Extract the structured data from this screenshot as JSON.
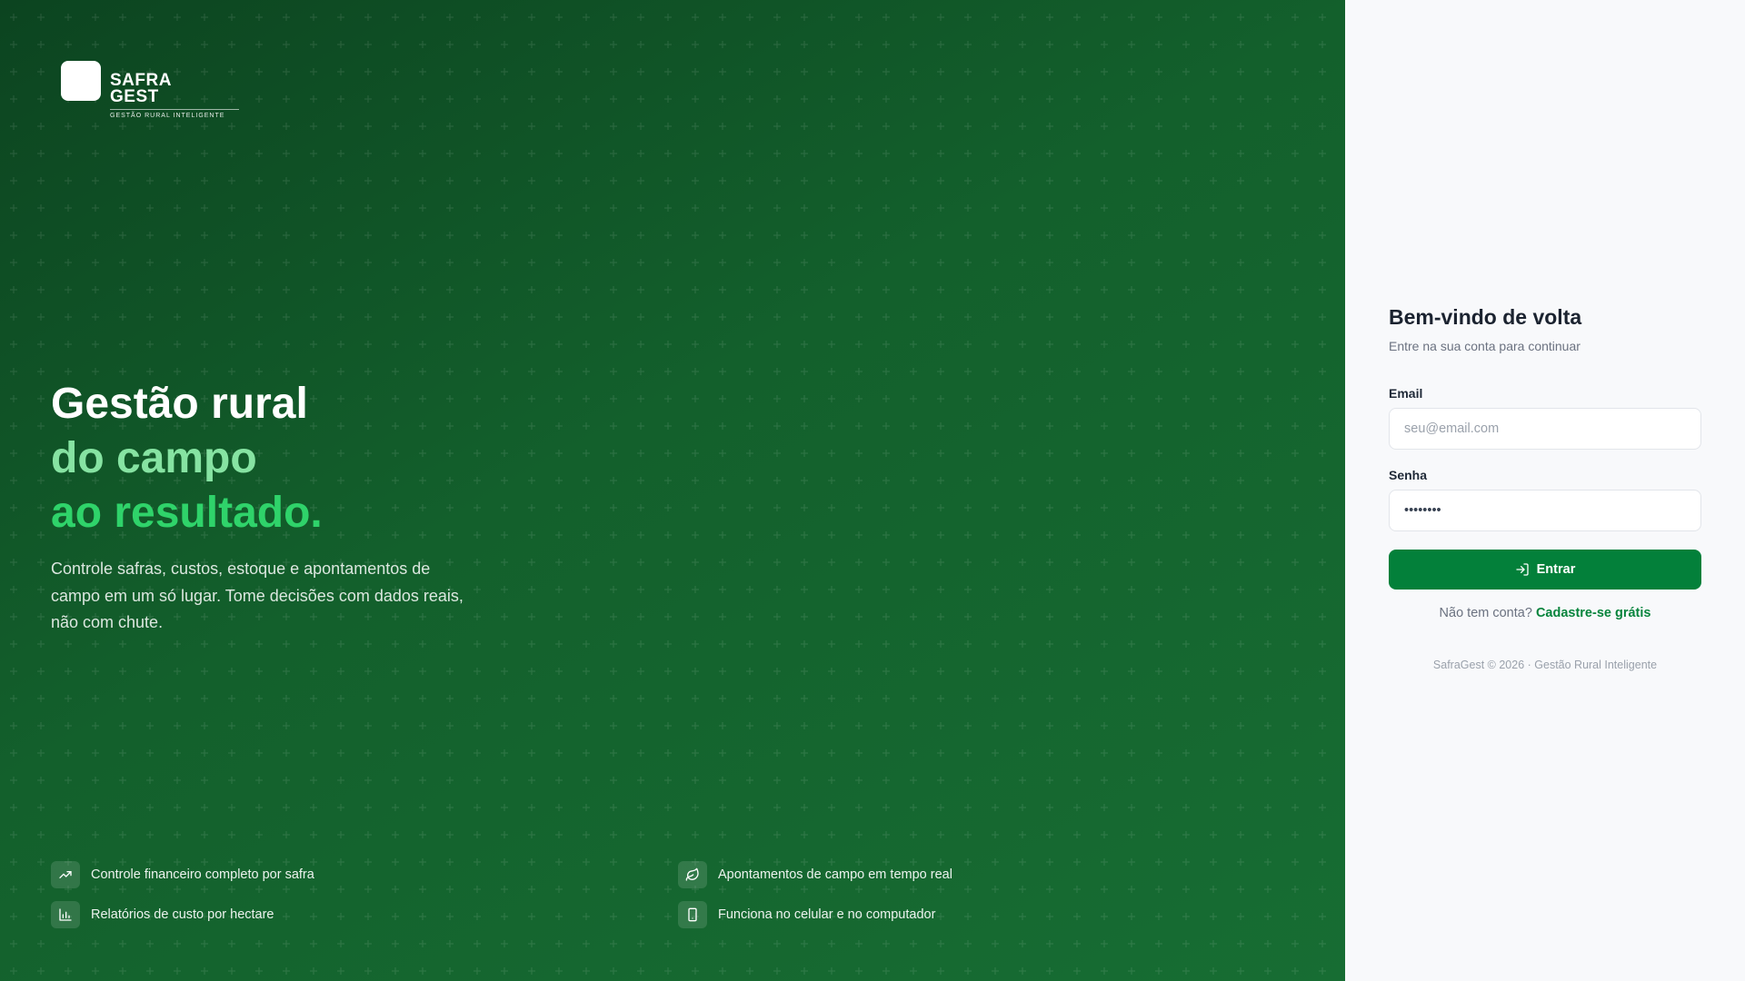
{
  "brand": {
    "line1": "SAFRA",
    "line2": "GEST",
    "tagline": "GESTÃO RURAL INTELIGENTE"
  },
  "hero": {
    "headline_line1": "Gestão rural",
    "headline_line2": "do campo",
    "headline_line3": "ao resultado.",
    "subtitle": "Controle safras, custos, estoque e apontamentos de campo em um só lugar. Tome decisões com dados reais, não com chute.",
    "features": [
      {
        "label": "Controle financeiro completo por safra",
        "icon": "trending-up-icon"
      },
      {
        "label": "Apontamentos de campo em tempo real",
        "icon": "leaf-icon"
      },
      {
        "label": "Relatórios de custo por hectare",
        "icon": "bar-chart-icon"
      },
      {
        "label": "Funciona no celular e no computador",
        "icon": "smartphone-icon"
      }
    ]
  },
  "login": {
    "title": "Bem-vindo de volta",
    "subtitle": "Entre na sua conta para continuar",
    "email_label": "Email",
    "email_placeholder": "seu@email.com",
    "password_label": "Senha",
    "password_value": "••••••••",
    "submit_label": "Entrar",
    "signup_prompt": "Não tem conta?",
    "signup_link": "Cadastre-se grátis",
    "footer": "SafraGest © 2026 · Gestão Rural Inteligente"
  },
  "colors": {
    "primary": "#03803a",
    "hero_dark": "#0c4420",
    "accent_light": "#86e3a2",
    "accent": "#2fd36a"
  }
}
